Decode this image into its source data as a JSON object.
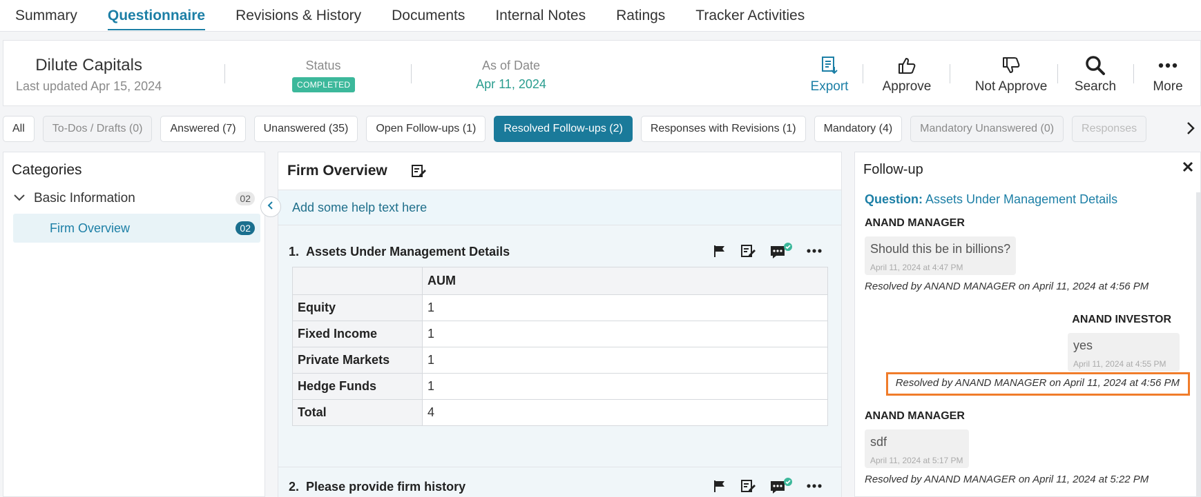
{
  "tabs": [
    "Summary",
    "Questionnaire",
    "Revisions & History",
    "Documents",
    "Internal Notes",
    "Ratings",
    "Tracker Activities"
  ],
  "active_tab": "Questionnaire",
  "header": {
    "fund_name": "Dilute Capitals",
    "last_updated": "Last updated Apr 15, 2024",
    "status_label": "Status",
    "status_value": "COMPLETED",
    "asof_label": "As of Date",
    "asof_value": "Apr 11, 2024",
    "actions": {
      "export": "Export",
      "approve": "Approve",
      "not_approve": "Not Approve",
      "search": "Search",
      "more": "More"
    }
  },
  "filters": [
    {
      "label": "All",
      "style": "normal"
    },
    {
      "label": "To-Dos / Drafts (0)",
      "style": "dim"
    },
    {
      "label": "Answered (7)",
      "style": "normal"
    },
    {
      "label": "Unanswered (35)",
      "style": "normal"
    },
    {
      "label": "Open Follow-ups (1)",
      "style": "normal"
    },
    {
      "label": "Resolved Follow-ups (2)",
      "style": "active"
    },
    {
      "label": "Responses with Revisions (1)",
      "style": "normal"
    },
    {
      "label": "Mandatory (4)",
      "style": "normal"
    },
    {
      "label": "Mandatory Unanswered (0)",
      "style": "dim"
    },
    {
      "label": "Responses",
      "style": "fade"
    }
  ],
  "categories": {
    "title": "Categories",
    "group": {
      "label": "Basic Information",
      "count": "02"
    },
    "item": {
      "label": "Firm Overview",
      "count": "02"
    }
  },
  "section": {
    "title": "Firm Overview",
    "help_text": "Add some help text here",
    "q1": {
      "number": "1.",
      "title": "Assets Under Management Details",
      "column": "AUM",
      "rows": [
        {
          "label": "Equity",
          "value": "1"
        },
        {
          "label": "Fixed Income",
          "value": "1"
        },
        {
          "label": "Private Markets",
          "value": "1"
        },
        {
          "label": "Hedge Funds",
          "value": "1"
        },
        {
          "label": "Total",
          "value": "4"
        }
      ]
    },
    "q2": {
      "number": "2.",
      "title": "Please provide firm history"
    }
  },
  "followup": {
    "title": "Follow-up",
    "question_label": "Question:",
    "question_value": "Assets Under Management Details",
    "threads": [
      {
        "author": "ANAND MANAGER",
        "message": "Should this be in billions?",
        "time": "April 11, 2024 at 4:47 PM",
        "resolved": "Resolved by ANAND MANAGER on April 11, 2024 at 4:56 PM"
      },
      {
        "author": "ANAND INVESTOR",
        "message": "yes",
        "time": "April 11, 2024 at 4:55 PM",
        "resolved": "Resolved by ANAND MANAGER on April 11, 2024 at 4:56 PM"
      },
      {
        "author": "ANAND MANAGER",
        "message": "sdf",
        "time": "April 11, 2024 at 5:17 PM",
        "resolved": "Resolved by ANAND MANAGER on April 11, 2024 at 5:22 PM"
      }
    ]
  },
  "colors": {
    "accent": "#1c7fa6",
    "active_chip": "#1a7a9a",
    "status_green": "#3cb89b",
    "highlight": "#f07c2a"
  },
  "icons": [
    "export-icon",
    "thumbs-up-icon",
    "thumbs-down-icon",
    "search-icon",
    "more-icon",
    "edit-icon",
    "flag-icon",
    "comment-check-icon",
    "ellipsis-icon",
    "close-icon",
    "chevron-right-icon",
    "chevron-left-icon",
    "chevron-down-icon"
  ]
}
